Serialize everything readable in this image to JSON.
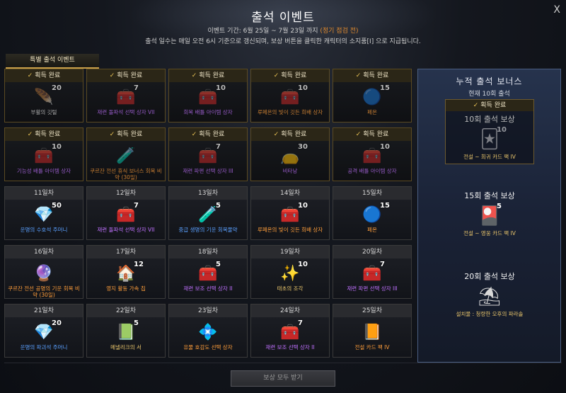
{
  "window": {
    "title": "출석 이벤트",
    "period_prefix": "이벤트 기간: 6월 25일 ~ 7월 23일 까지 ",
    "period_note": "(정기 점검 전)",
    "description": "출석 일수는 매일 오전 6시 기준으로 갱신되며, 보상 버튼을 클릭한 캐릭터의 소지품[I] 으로 지급됩니다.",
    "close_icon": "close-icon",
    "close_glyph": "X"
  },
  "tab": {
    "label": "특별 출석 이벤트"
  },
  "days": [
    {
      "label": "획득 완료",
      "done": true,
      "qty": "20",
      "name": "부활의 깃털",
      "color": "white",
      "icon": "feather-icon",
      "glyph": "🪶"
    },
    {
      "label": "획득 완료",
      "done": true,
      "qty": "7",
      "name": "재련 돌파석 선택 상자 VII",
      "color": "purple",
      "icon": "chest-icon",
      "glyph": "🧰"
    },
    {
      "label": "획득 완료",
      "done": true,
      "qty": "10",
      "name": "회복 배틀 아이템 상자",
      "color": "purple",
      "icon": "chest-icon",
      "glyph": "🧰"
    },
    {
      "label": "획득 완료",
      "done": true,
      "qty": "10",
      "name": "루페온의 빛이 깃든 희배 상자",
      "color": "orange",
      "icon": "chest-icon",
      "glyph": "🧰"
    },
    {
      "label": "획득 완료",
      "done": true,
      "qty": "15",
      "name": "페온",
      "color": "orange",
      "icon": "orb-icon",
      "glyph": "🔵"
    },
    {
      "label": "획득 완료",
      "done": true,
      "qty": "10",
      "name": "기능성 배틀 아이템 상자",
      "color": "purple",
      "icon": "chest-icon",
      "glyph": "🧰"
    },
    {
      "label": "획득 완료",
      "done": true,
      "qty": "",
      "name": "쿠르잔 전선 휴식 보너스 회복 비약 (30일)",
      "color": "orange",
      "icon": "potion-icon",
      "glyph": "🧪"
    },
    {
      "label": "획득 완료",
      "done": true,
      "qty": "7",
      "name": "재련 파편 선택 상자 III",
      "color": "purple",
      "icon": "chest-icon",
      "glyph": "🧰"
    },
    {
      "label": "획득 완료",
      "done": true,
      "qty": "30",
      "name": "비타낭",
      "color": "purple",
      "icon": "pouch-icon",
      "glyph": "👝"
    },
    {
      "label": "획득 완료",
      "done": true,
      "qty": "10",
      "name": "공격 배틀 아이템 상자",
      "color": "purple",
      "icon": "chest-icon",
      "glyph": "🧰"
    },
    {
      "label": "11일차",
      "done": false,
      "qty": "50",
      "name": "운명의 수호석 주머니",
      "color": "blue",
      "icon": "pouch-icon",
      "glyph": "💎"
    },
    {
      "label": "12일차",
      "done": false,
      "qty": "7",
      "name": "재련 돌파석 선택 상자 VII",
      "color": "purple",
      "icon": "chest-icon",
      "glyph": "🧰"
    },
    {
      "label": "13일차",
      "done": false,
      "qty": "5",
      "name": "중급 생명의 기운 회복물약",
      "color": "blue",
      "icon": "potion-icon",
      "glyph": "🧪"
    },
    {
      "label": "14일차",
      "done": false,
      "qty": "10",
      "name": "루페온의 빛이 깃든 희배 상자",
      "color": "orange",
      "icon": "chest-icon",
      "glyph": "🧰"
    },
    {
      "label": "15일차",
      "done": false,
      "qty": "15",
      "name": "페온",
      "color": "orange",
      "icon": "orb-icon",
      "glyph": "🔵"
    },
    {
      "label": "16일차",
      "done": false,
      "qty": "",
      "name": "쿠르잔 전선 공명의 기운 회복 비약 (30일)",
      "color": "orange",
      "icon": "potion-icon",
      "glyph": "🔮"
    },
    {
      "label": "17일차",
      "done": false,
      "qty": "12",
      "name": "영지 활동 가속 칩",
      "color": "orange",
      "icon": "house-icon",
      "glyph": "🏠"
    },
    {
      "label": "18일차",
      "done": false,
      "qty": "5",
      "name": "재련 보조 선택 상자 II",
      "color": "purple",
      "icon": "chest-icon",
      "glyph": "🧰"
    },
    {
      "label": "19일차",
      "done": false,
      "qty": "10",
      "name": "태초의 조각",
      "color": "gold",
      "icon": "shard-icon",
      "glyph": "✨"
    },
    {
      "label": "20일차",
      "done": false,
      "qty": "7",
      "name": "재련 파편 선택 상자 III",
      "color": "purple",
      "icon": "chest-icon",
      "glyph": "🧰"
    },
    {
      "label": "21일차",
      "done": false,
      "qty": "20",
      "name": "운명의 파괴석 주머니",
      "color": "blue",
      "icon": "pouch-icon",
      "glyph": "💎"
    },
    {
      "label": "22일차",
      "done": false,
      "qty": "5",
      "name": "메넬리크의 서",
      "color": "gold",
      "icon": "book-icon",
      "glyph": "📗"
    },
    {
      "label": "23일차",
      "done": false,
      "qty": "",
      "name": "유물 호감도 선택 상자",
      "color": "orange",
      "icon": "gem-icon",
      "glyph": "💠"
    },
    {
      "label": "24일차",
      "done": false,
      "qty": "7",
      "name": "재련 보조 선택 상자 II",
      "color": "purple",
      "icon": "chest-icon",
      "glyph": "🧰"
    },
    {
      "label": "25일차",
      "done": false,
      "qty": "",
      "name": "전설 카드 팩 IV",
      "color": "orange",
      "icon": "book-icon",
      "glyph": "📙"
    }
  ],
  "bonus": {
    "title": "누적 출석 보너스",
    "current": "현재 10회 출석",
    "rewards": [
      {
        "status": "획득 완료",
        "done": true,
        "title": "10회 출석 보상",
        "qty": "10",
        "name": "전설 ~ 희귀 카드 팩 IV",
        "color": "gold",
        "icon": "card-pack-icon",
        "glyph": "🃏"
      },
      {
        "status": "",
        "done": false,
        "title": "15회 출석 보상",
        "qty": "5",
        "name": "전설 ~ 영웅 카드 팩 IV",
        "color": "gold",
        "icon": "card-pack-icon",
        "glyph": "🎴"
      },
      {
        "status": "",
        "done": false,
        "title": "20회 출석 보상",
        "qty": "",
        "name": "설치물 : 청량한 오후의 파라솔",
        "color": "gold",
        "icon": "parasol-icon",
        "glyph": "⛱"
      }
    ]
  },
  "footer": {
    "claim_all": "보상 모두 받기"
  }
}
